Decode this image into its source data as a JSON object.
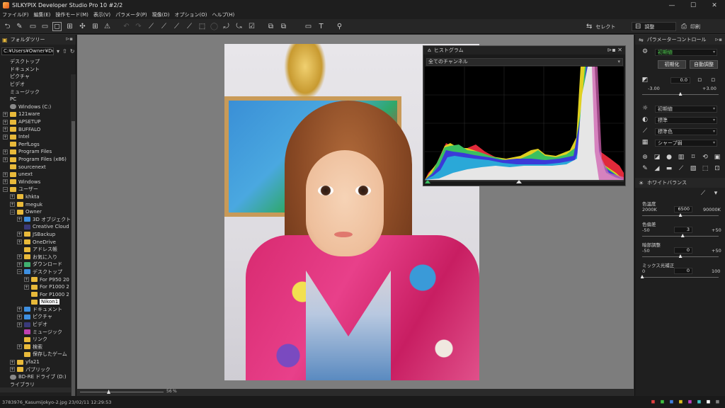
{
  "window": {
    "title": "SILKYPIX Developer Studio Pro 10   #2/2",
    "controls": [
      "—",
      "☐",
      "✕"
    ]
  },
  "menu": [
    "ファイル(F)",
    "編集(E)",
    "操作モード(M)",
    "表示(V)",
    "パラメータ(P)",
    "現像(D)",
    "オプション(O)",
    "ヘルプ(H)"
  ],
  "toolbar": {
    "buttons": [
      "⮌",
      "✎",
      "▭",
      "▭",
      "◻",
      "⊞",
      "✣",
      "⊞",
      "⚠",
      "↶",
      "↷",
      "⟋",
      "⟋",
      "⟋",
      "⟋",
      "⬚",
      "◯",
      "⤾",
      "⤿",
      "☑",
      "⧉",
      "⧉",
      "▭",
      "T",
      "⚲"
    ],
    "mode_select": "セレクト",
    "mode_adjust": "調整",
    "mode_print": "印刷"
  },
  "left_panel": {
    "title": "フォルダツリー",
    "path": "C:¥Users¥Owner¥De",
    "tree": [
      {
        "label": "デスクトップ",
        "depth": 0,
        "exp": "none",
        "icon": "none"
      },
      {
        "label": "ドキュメント",
        "depth": 0,
        "exp": "none",
        "icon": "none"
      },
      {
        "label": "ピクチャ",
        "depth": 0,
        "exp": "none",
        "icon": "none"
      },
      {
        "label": "ビデオ",
        "depth": 0,
        "exp": "none",
        "icon": "none"
      },
      {
        "label": "ミュージック",
        "depth": 0,
        "exp": "none",
        "icon": "none"
      },
      {
        "label": "PC",
        "depth": 0,
        "exp": "none",
        "icon": "none"
      },
      {
        "label": "Windows (C:)",
        "depth": 0,
        "exp": "none",
        "icon": "disc"
      },
      {
        "label": "121ware",
        "depth": 0,
        "exp": "+",
        "icon": "folder"
      },
      {
        "label": "APSETUP",
        "depth": 0,
        "exp": "+",
        "icon": "folder"
      },
      {
        "label": "BUFFALO",
        "depth": 0,
        "exp": "+",
        "icon": "folder"
      },
      {
        "label": "Intel",
        "depth": 0,
        "exp": "+",
        "icon": "folder"
      },
      {
        "label": "PerfLogs",
        "depth": 0,
        "exp": "none",
        "icon": "folder"
      },
      {
        "label": "Program Files",
        "depth": 0,
        "exp": "+",
        "icon": "folder"
      },
      {
        "label": "Program Files (x86)",
        "depth": 0,
        "exp": "+",
        "icon": "folder"
      },
      {
        "label": "sourcenext",
        "depth": 0,
        "exp": "none",
        "icon": "folder"
      },
      {
        "label": "unext",
        "depth": 0,
        "exp": "+",
        "icon": "folder"
      },
      {
        "label": "Windows",
        "depth": 0,
        "exp": "+",
        "icon": "folder"
      },
      {
        "label": "ユーザー",
        "depth": 0,
        "exp": "−",
        "icon": "folder"
      },
      {
        "label": "khkta",
        "depth": 1,
        "exp": "+",
        "icon": "folder"
      },
      {
        "label": "meguk",
        "depth": 1,
        "exp": "+",
        "icon": "folder"
      },
      {
        "label": "Owner",
        "depth": 1,
        "exp": "−",
        "icon": "folder"
      },
      {
        "label": "3D オブジェクト",
        "depth": 2,
        "exp": "+",
        "icon": "blue"
      },
      {
        "label": "Creative Cloud",
        "depth": 2,
        "exp": "none",
        "icon": "dark"
      },
      {
        "label": "JSBackup",
        "depth": 2,
        "exp": "+",
        "icon": "folder"
      },
      {
        "label": "OneDrive",
        "depth": 2,
        "exp": "+",
        "icon": "folder"
      },
      {
        "label": "アドレス帳",
        "depth": 2,
        "exp": "none",
        "icon": "folder"
      },
      {
        "label": "お気に入り",
        "depth": 2,
        "exp": "+",
        "icon": "folder"
      },
      {
        "label": "ダウンロード",
        "depth": 2,
        "exp": "+",
        "icon": "green"
      },
      {
        "label": "デスクトップ",
        "depth": 2,
        "exp": "−",
        "icon": "blue"
      },
      {
        "label": "For P950 20",
        "depth": 3,
        "exp": "+",
        "icon": "folder"
      },
      {
        "label": "For P1000 2",
        "depth": 3,
        "exp": "+",
        "icon": "folder"
      },
      {
        "label": "For P1000 2",
        "depth": 3,
        "exp": "none",
        "icon": "folder"
      },
      {
        "label": "Nikon1",
        "depth": 3,
        "exp": "none",
        "icon": "folder",
        "selected": true
      },
      {
        "label": "ドキュメント",
        "depth": 2,
        "exp": "+",
        "icon": "blue"
      },
      {
        "label": "ピクチャ",
        "depth": 2,
        "exp": "+",
        "icon": "blue"
      },
      {
        "label": "ビデオ",
        "depth": 2,
        "exp": "+",
        "icon": "dark"
      },
      {
        "label": "ミュージック",
        "depth": 2,
        "exp": "none",
        "icon": "pink"
      },
      {
        "label": "リンク",
        "depth": 2,
        "exp": "none",
        "icon": "folder"
      },
      {
        "label": "検索",
        "depth": 2,
        "exp": "+",
        "icon": "folder"
      },
      {
        "label": "保存したゲーム",
        "depth": 2,
        "exp": "none",
        "icon": "folder"
      },
      {
        "label": "yfa21",
        "depth": 1,
        "exp": "+",
        "icon": "folder"
      },
      {
        "label": "パブリック",
        "depth": 1,
        "exp": "+",
        "icon": "folder"
      },
      {
        "label": "BD-RE ドライブ (D:)",
        "depth": 0,
        "exp": "none",
        "icon": "disc"
      },
      {
        "label": "ライブラリ",
        "depth": 0,
        "exp": "none",
        "icon": "none"
      }
    ]
  },
  "viewer": {
    "zoom_value": "56",
    "zoom_unit": "%"
  },
  "histogram": {
    "title": "ヒストグラム",
    "channel": "全てのチャンネル"
  },
  "right_panel": {
    "title": "パラメーターコントロール",
    "preset": "初期値",
    "reset_button": "初期化",
    "auto_button": "自動調整",
    "exposure": {
      "value": "0.0",
      "min": "-3.00",
      "max": "+3.00",
      "level": 0.5
    },
    "tone_rows": [
      "初期値",
      "標準",
      "標準色",
      "シャープ弱"
    ],
    "wb_title": "ホワイトバランス",
    "temp": {
      "label": "色温度",
      "value": "6500",
      "min": "2000K",
      "max": "90000K",
      "level": 0.5
    },
    "tint": {
      "label": "色偏差",
      "value": "3",
      "min": "-50",
      "max": "+50",
      "level": 0.53
    },
    "fine": {
      "label": "暗部調整",
      "value": "0",
      "min": "-50",
      "max": "+50",
      "level": 0.5
    },
    "mix": {
      "label": "ミックス光補正",
      "value": "0",
      "min": "0",
      "max": "100",
      "level": 0.0
    }
  },
  "status": {
    "file": "3783976_Kasumijokyo-2.jpg 23/02/11 12:29:53",
    "colors": [
      "#e04040",
      "#40c040",
      "#4080e0",
      "#e0c020",
      "#c040c0",
      "#40c0c0",
      "#ffffff",
      "#808080"
    ]
  }
}
